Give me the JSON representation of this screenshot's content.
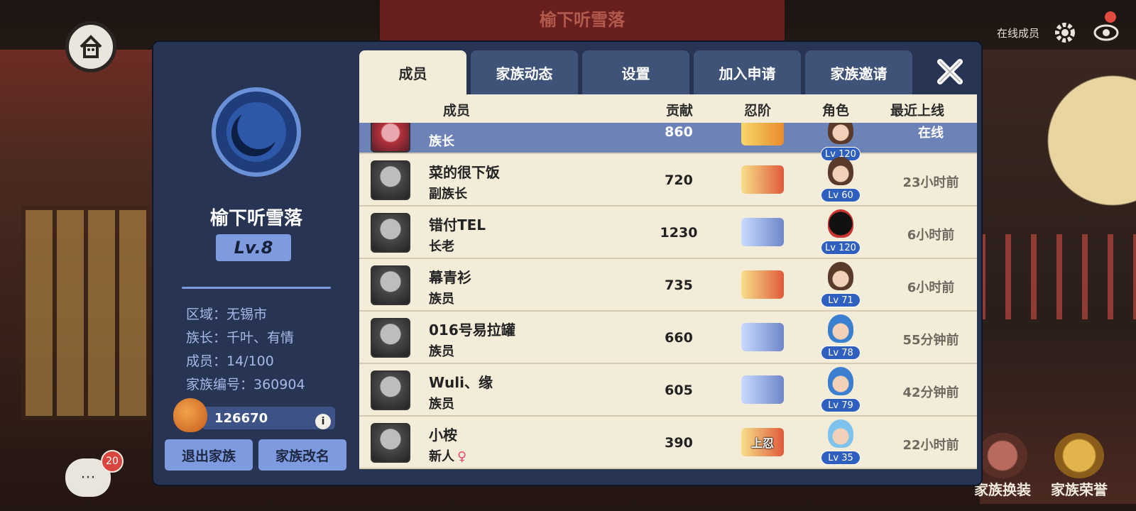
{
  "background": {
    "top_banner": "榆下听雪落"
  },
  "topbar": {
    "online_label": "在线成员",
    "settings_icon": "gear-icon",
    "view_icon": "eye-icon"
  },
  "chat": {
    "badge_count": "20"
  },
  "bottom_buttons": [
    {
      "label": "家族换装"
    },
    {
      "label": "家族荣誉"
    }
  ],
  "clan": {
    "name": "榆下听雪落",
    "level": "Lv.8",
    "info": [
      "区域：无锡市",
      "族长：千叶、有情",
      "成员：14/100",
      "家族编号：360904"
    ],
    "funds": "126670",
    "funds_info": "i",
    "buttons": {
      "leave": "退出家族",
      "rename": "家族改名"
    }
  },
  "tabs": [
    {
      "label": "成员",
      "active": true
    },
    {
      "label": "家族动态",
      "active": false
    },
    {
      "label": "设置",
      "active": false
    },
    {
      "label": "加入申请",
      "active": false
    },
    {
      "label": "家族邀请",
      "active": false
    }
  ],
  "table": {
    "headers": {
      "member": "成员",
      "contribution": "贡献",
      "rank": "忍阶",
      "character": "角色",
      "last_online": "最近上线"
    },
    "rows": [
      {
        "name": "",
        "role": "族长",
        "contribution": "860",
        "rank": "",
        "rank_style": "gold",
        "char_lv": "Lv 120",
        "last_online": "在线"
      },
      {
        "name": "菜的很下饭",
        "role": "副族长",
        "contribution": "720",
        "rank": "",
        "rank_style": "red",
        "char_lv": "Lv 60",
        "last_online": "23小时前"
      },
      {
        "name": "错付TEL",
        "role": "长老",
        "contribution": "1230",
        "rank": "",
        "rank_style": "blue",
        "char_lv": "Lv 120",
        "last_online": "6小时前"
      },
      {
        "name": "幕青衫",
        "role": "族员",
        "contribution": "735",
        "rank": "",
        "rank_style": "red",
        "char_lv": "Lv 71",
        "last_online": "6小时前"
      },
      {
        "name": "016号易拉罐",
        "role": "族员",
        "contribution": "660",
        "rank": "",
        "rank_style": "blue",
        "char_lv": "Lv 78",
        "last_online": "55分钟前"
      },
      {
        "name": "Wuli、缘",
        "role": "族员",
        "contribution": "605",
        "rank": "",
        "rank_style": "blue",
        "char_lv": "Lv 79",
        "last_online": "42分钟前"
      },
      {
        "name": "小桉",
        "role": "新人",
        "gender": "♀",
        "contribution": "390",
        "rank": "上忍",
        "rank_style": "red",
        "char_lv": "Lv 35",
        "last_online": "22小时前"
      }
    ]
  }
}
